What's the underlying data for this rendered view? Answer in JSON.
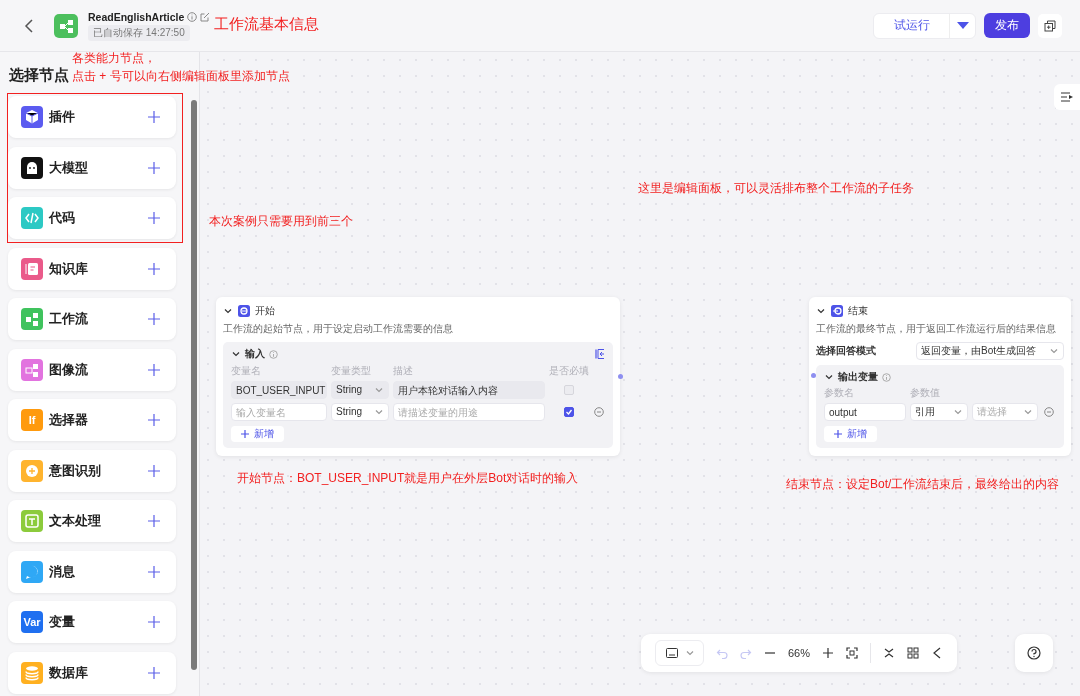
{
  "header": {
    "title": "ReadEnglishArticle",
    "save_status": "已自动保存 14:27:50",
    "test_run_button": "试运行",
    "publish_button": "发布"
  },
  "sidebar": {
    "title": "选择节点",
    "items": [
      {
        "label": "插件",
        "kind": "plugin",
        "color": "#5b5bf0"
      },
      {
        "label": "大模型",
        "kind": "llm",
        "color": "#111111"
      },
      {
        "label": "代码",
        "kind": "code",
        "color": "#2cc9c4"
      },
      {
        "label": "知识库",
        "kind": "knowledge",
        "color": "#ea5a8a"
      },
      {
        "label": "工作流",
        "kind": "workflow",
        "color": "#3fc35d"
      },
      {
        "label": "图像流",
        "kind": "imageflow",
        "color": "#e273df"
      },
      {
        "label": "选择器",
        "kind": "selector",
        "color": "#ff9a0d",
        "icon_text": "If"
      },
      {
        "label": "意图识别",
        "kind": "intent",
        "color": "#ffb42e"
      },
      {
        "label": "文本处理",
        "kind": "text",
        "color": "#8ccb3c"
      },
      {
        "label": "消息",
        "kind": "message",
        "color": "#2fa8f5"
      },
      {
        "label": "变量",
        "kind": "variable",
        "color": "#1f6ff0",
        "icon_text": "Var"
      },
      {
        "label": "数据库",
        "kind": "database",
        "color": "#ffb020"
      }
    ]
  },
  "start_node": {
    "title": "开始",
    "description": "工作流的起始节点，用于设定启动工作流需要的信息",
    "section": {
      "title": "输入",
      "expanded": true,
      "columns": [
        "变量名",
        "变量类型",
        "描述",
        "是否必填"
      ],
      "rows": [
        {
          "name": {
            "value": "BOT_USER_INPUT"
          },
          "type": "String",
          "description": {
            "value": "用户本轮对话输入内容"
          },
          "required": false,
          "disabled": true,
          "removable": false
        },
        {
          "name": {
            "placeholder": "输入变量名"
          },
          "type": "String",
          "description": {
            "placeholder": "请描述变量的用途"
          },
          "required": true,
          "disabled": false,
          "removable": true
        }
      ],
      "add_button": "新增"
    }
  },
  "end_node": {
    "title": "结束",
    "description": "工作流的最终节点，用于返回工作流运行后的结果信息",
    "mode_label": "选择回答模式",
    "mode_value": "返回变量，由Bot生成回答",
    "section": {
      "title": "输出变量",
      "expanded": true,
      "columns": [
        "参数名",
        "参数值"
      ],
      "rows": [
        {
          "name": {
            "value": "output"
          },
          "source": "引用",
          "reference": {
            "placeholder": "请选择"
          },
          "removable": true
        }
      ],
      "add_button": "新增"
    }
  },
  "toolbar": {
    "items": [
      {
        "kind": "screen-select"
      },
      {
        "kind": "undo",
        "disabled": true
      },
      {
        "kind": "redo",
        "disabled": true
      },
      {
        "kind": "zoom-out",
        "disabled": false
      },
      {
        "kind": "zoom-level",
        "text": "66%"
      },
      {
        "kind": "zoom-in",
        "disabled": false
      },
      {
        "kind": "fit",
        "disabled": false
      },
      {
        "kind": "divider"
      },
      {
        "kind": "collapse",
        "disabled": false
      },
      {
        "kind": "layout",
        "disabled": false
      },
      {
        "kind": "pointer",
        "disabled": false
      }
    ]
  },
  "annotations": [
    {
      "kind": "note",
      "text": "工作流基本信息"
    },
    {
      "kind": "note",
      "text": "各类能力节点，"
    },
    {
      "kind": "note",
      "text": "点击 + 号可以向右侧编辑面板里添加节点"
    },
    {
      "kind": "box"
    },
    {
      "kind": "note",
      "text": "本次案例只需要用到前三个"
    },
    {
      "kind": "note",
      "text": "这里是编辑面板，可以灵活排布整个工作流的子任务"
    },
    {
      "kind": "note",
      "text": "开始节点：BOT_USER_INPUT就是用户在外层Bot对话时的输入"
    },
    {
      "kind": "note",
      "text": "结束节点：设定Bot/工作流结束后，最终给出的内容"
    }
  ]
}
